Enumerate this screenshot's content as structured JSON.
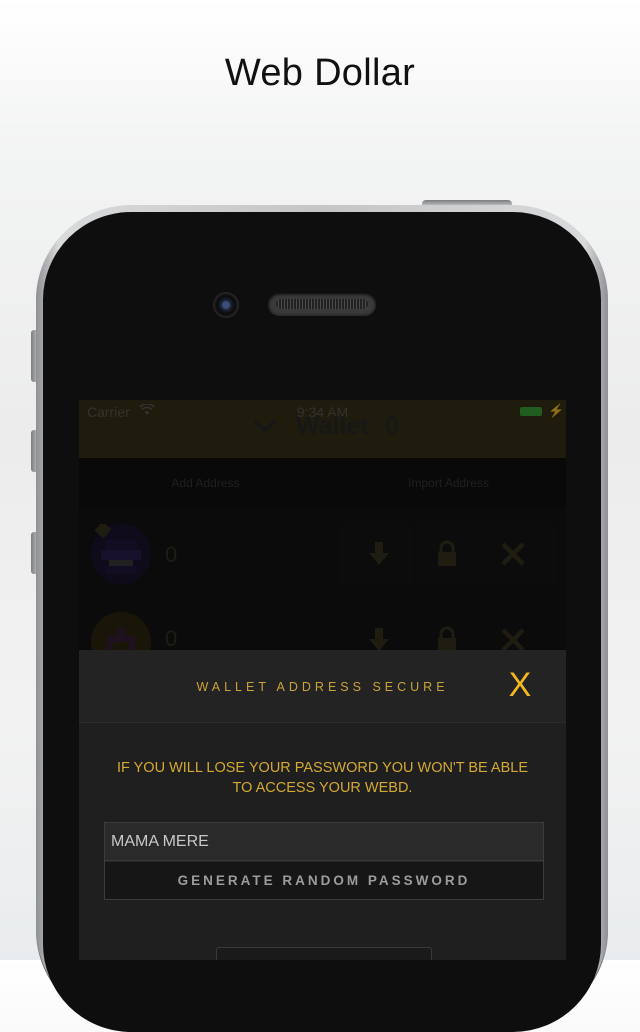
{
  "page": {
    "title": "Web Dollar"
  },
  "status_bar": {
    "carrier": "Carrier",
    "time": "9:34 AM"
  },
  "header": {
    "title": "Wallet",
    "balance": "0"
  },
  "tabs": [
    {
      "label": "Add Address"
    },
    {
      "label": "Import Address"
    }
  ],
  "wallet_rows": [
    {
      "balance": "0"
    },
    {
      "balance": "0"
    }
  ],
  "modal": {
    "title": "WALLET ADDRESS SECURE",
    "close_label": "X",
    "warning": "IF YOU WILL LOSE YOUR PASSWORD YOU WON'T BE ABLE TO ACCESS YOUR WEBD.",
    "password_value": "MAMA MERE",
    "generate_label": "GENERATE RANDOM PASSWORD"
  },
  "colors": {
    "accent": "#f2b821",
    "header_bg": "#3b3419",
    "modal_bg": "#1f1f1f"
  }
}
